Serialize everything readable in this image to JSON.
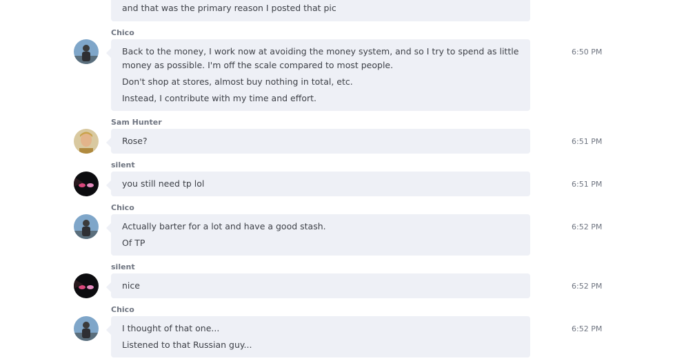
{
  "messages": [
    {
      "lines": [
        "and that was the primary reason I posted that pic"
      ]
    },
    {
      "author": "Chico",
      "time": "6:50 PM",
      "avatar": "landscape-photo-avatar",
      "lines": [
        "Back to the money, I work now at avoiding the money system, and so I try to spend as little",
        "money as possible.  I'm off the scale compared to most people.",
        "Don't shop at stores, almost buy nothing in total, etc.",
        "Instead, I contribute with my time and effort."
      ]
    },
    {
      "author": "Sam Hunter",
      "time": "6:51 PM",
      "avatar": "portrait-photo-avatar",
      "lines": [
        "Rose?"
      ]
    },
    {
      "author": "silent",
      "time": "6:51 PM",
      "avatar": "anime-eyes-avatar",
      "lines": [
        "you still need tp lol"
      ]
    },
    {
      "author": "Chico",
      "time": "6:52 PM",
      "avatar": "landscape-photo-avatar",
      "lines": [
        "Actually barter for a lot and have a good stash.",
        "Of TP"
      ]
    },
    {
      "author": "silent",
      "time": "6:52 PM",
      "avatar": "anime-eyes-avatar",
      "lines": [
        "nice"
      ]
    },
    {
      "author": "Chico",
      "time": "6:52 PM",
      "avatar": "landscape-photo-avatar",
      "lines": [
        "I thought of that one...",
        "Listened to that Russian guy..."
      ]
    }
  ],
  "colors": {
    "bubble": "#eef0f6",
    "text": "#3d4047",
    "meta": "#6e7480"
  }
}
